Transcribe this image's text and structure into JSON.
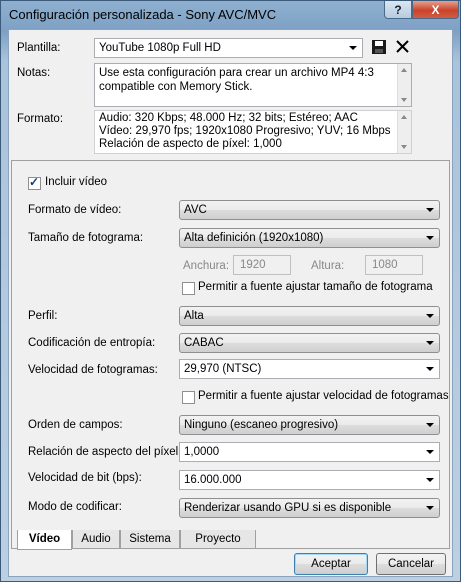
{
  "window": {
    "title": "Configuración personalizada - Sony AVC/MVC",
    "help_label": "?",
    "close_label": "X"
  },
  "top": {
    "template_label": "Plantilla:",
    "template_value": "YouTube 1080p Full HD",
    "notes_label": "Notas:",
    "notes_lines": [
      "Use esta configuración para crear un archivo MP4 4:3",
      "compatible con Memory Stick."
    ],
    "format_label": "Formato:",
    "format_lines": [
      "Audio: 320 Kbps; 48.000 Hz; 32 bits; Estéreo; AAC",
      "Vídeo: 29,970 fps; 1920x1080 Progresivo; YUV; 16 Mbps",
      "Relación de aspecto de píxel: 1,000"
    ]
  },
  "video": {
    "include_video_label": "Incluir vídeo",
    "include_video_checked": true,
    "format_label": "Formato de vídeo:",
    "format_value": "AVC",
    "frame_size_label": "Tamaño de fotograma:",
    "frame_size_value": "Alta definición (1920x1080)",
    "width_label": "Anchura:",
    "width_value": "1920",
    "height_label": "Altura:",
    "height_value": "1080",
    "allow_size_label": "Permitir a fuente ajustar tamaño de fotograma",
    "allow_size_checked": false,
    "profile_label": "Perfil:",
    "profile_value": "Alta",
    "entropy_label": "Codificación de entropía:",
    "entropy_value": "CABAC",
    "fps_label": "Velocidad de fotogramas:",
    "fps_value": "29,970 (NTSC)",
    "allow_fps_label": "Permitir a fuente ajustar velocidad de fotogramas",
    "allow_fps_checked": false,
    "field_order_label": "Orden de campos:",
    "field_order_value": "Ninguno (escaneo progresivo)",
    "pixel_aspect_label": "Relación de aspecto del píxel:",
    "pixel_aspect_value": "1,0000",
    "bitrate_label": "Velocidad de bit (bps):",
    "bitrate_value": "16.000.000",
    "encode_mode_label": "Modo de codificar:",
    "encode_mode_value": "Renderizar usando GPU si es disponible"
  },
  "tabs": [
    "Vídeo",
    "Audio",
    "Sistema",
    "Proyecto"
  ],
  "buttons": {
    "accept": "Aceptar",
    "cancel": "Cancelar"
  }
}
